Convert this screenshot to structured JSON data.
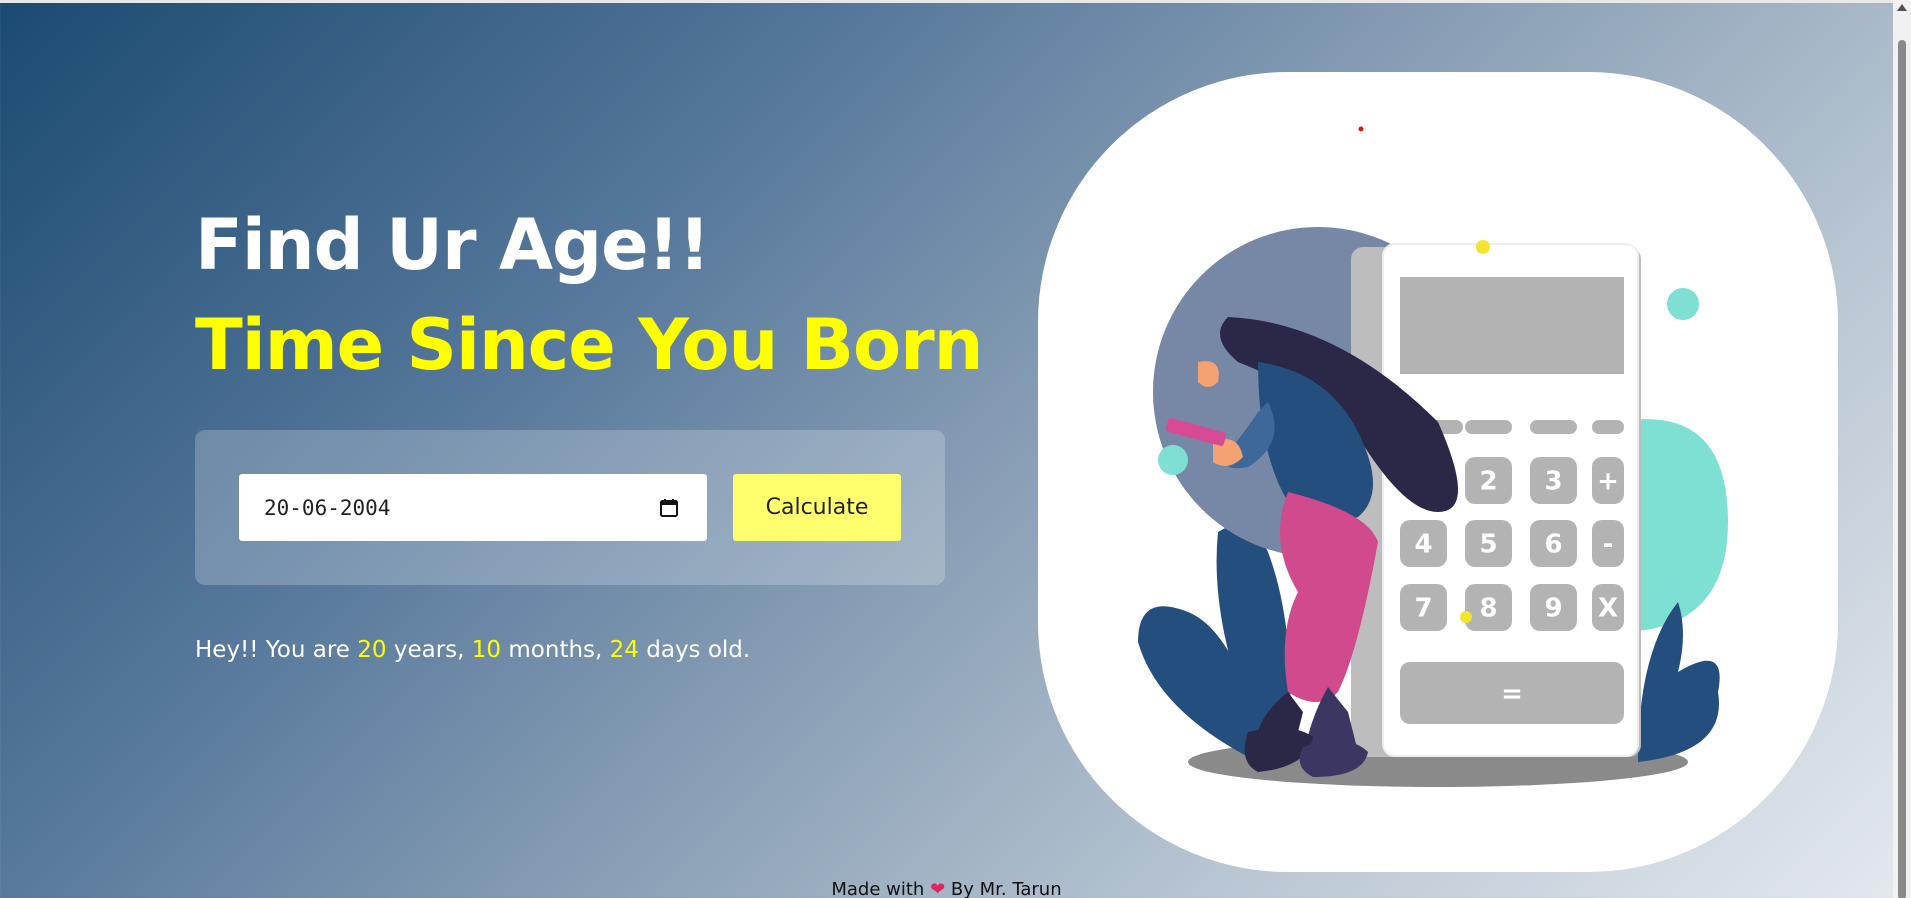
{
  "hero": {
    "title": "Find Ur Age!!",
    "subtitle": "Time Since You Born"
  },
  "form": {
    "date_value": "20-06-2004",
    "calculate_label": "Calculate"
  },
  "result": {
    "prefix": "Hey!! You are",
    "years": "20",
    "years_label": "years,",
    "months": "10",
    "months_label": "months,",
    "days": "24",
    "days_label": "days old."
  },
  "calculator": {
    "keys": [
      "2",
      "3",
      "+",
      "4",
      "5",
      "6",
      "-",
      "7",
      "8",
      "9",
      "X",
      "="
    ]
  },
  "footer": {
    "made_with": "Made with",
    "by": "By Mr. Tarun"
  },
  "colors": {
    "accent": "#ffff00",
    "button": "#ffff6e",
    "heart": "#e0245e"
  }
}
